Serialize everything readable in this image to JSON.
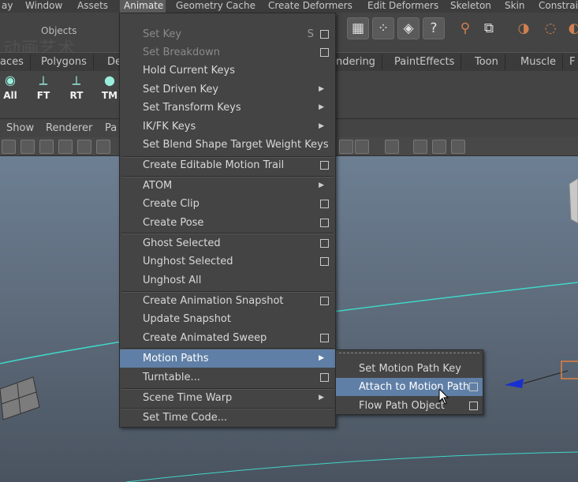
{
  "menubar": [
    {
      "label": "ay",
      "active": false
    },
    {
      "label": "Window",
      "active": false
    },
    {
      "label": "Assets",
      "active": false
    },
    {
      "label": "Animate",
      "active": true
    },
    {
      "label": "Geometry Cache",
      "active": false
    },
    {
      "label": "Create Deformers",
      "active": false
    },
    {
      "label": "Edit Deformers",
      "active": false
    },
    {
      "label": "Skeleton",
      "active": false
    },
    {
      "label": "Skin",
      "active": false
    },
    {
      "label": "Constrain",
      "active": false
    }
  ],
  "objects_label": "Objects",
  "watermark": "动画艺术",
  "shelf_tabs": [
    "aces",
    "Polygons",
    "De",
    "ndering",
    "PaintEffects",
    "Toon",
    "Muscle",
    "F"
  ],
  "shelf_icons": [
    "All",
    "FT",
    "RT",
    "TM"
  ],
  "panel_menu": [
    "Show",
    "Renderer",
    "Pa"
  ],
  "animate_menu": {
    "items": [
      {
        "label": "Set Key",
        "disabled": true,
        "hotkey": "S",
        "option": true
      },
      {
        "label": "Set Breakdown",
        "disabled": true,
        "option": true
      },
      {
        "label": "Hold Current Keys"
      },
      {
        "label": "Set Driven Key",
        "submenu": true
      },
      {
        "label": "Set Transform Keys",
        "submenu": true
      },
      {
        "label": "IK/FK Keys",
        "submenu": true
      },
      {
        "label": "Set Blend Shape Target Weight Keys"
      },
      {
        "label": "Create Editable Motion Trail",
        "option": true
      },
      {
        "label": "ATOM",
        "submenu": true
      },
      {
        "label": "Create Clip",
        "option": true
      },
      {
        "label": "Create Pose",
        "option": true
      },
      {
        "label": "Ghost Selected",
        "option": true
      },
      {
        "label": "Unghost Selected",
        "option": true
      },
      {
        "label": "Unghost All"
      },
      {
        "label": "Create Animation Snapshot",
        "option": true
      },
      {
        "label": "Update Snapshot"
      },
      {
        "label": "Create Animated Sweep",
        "option": true
      },
      {
        "label": "Motion Paths",
        "submenu": true,
        "highlighted": true
      },
      {
        "label": "Turntable...",
        "option": true
      },
      {
        "label": "Scene Time Warp",
        "submenu": true
      },
      {
        "label": "Set Time Code..."
      }
    ]
  },
  "motion_paths_submenu": {
    "items": [
      {
        "label": "Set Motion Path Key"
      },
      {
        "label": "Attach to Motion Path",
        "option": true,
        "highlighted": true
      },
      {
        "label": "Flow Path Object",
        "option": true
      }
    ]
  },
  "colors": {
    "menu_bg": "#444444",
    "highlight": "#5f7fa6",
    "viewport_top": "#6d7f93",
    "curve": "#3fd6c8"
  }
}
